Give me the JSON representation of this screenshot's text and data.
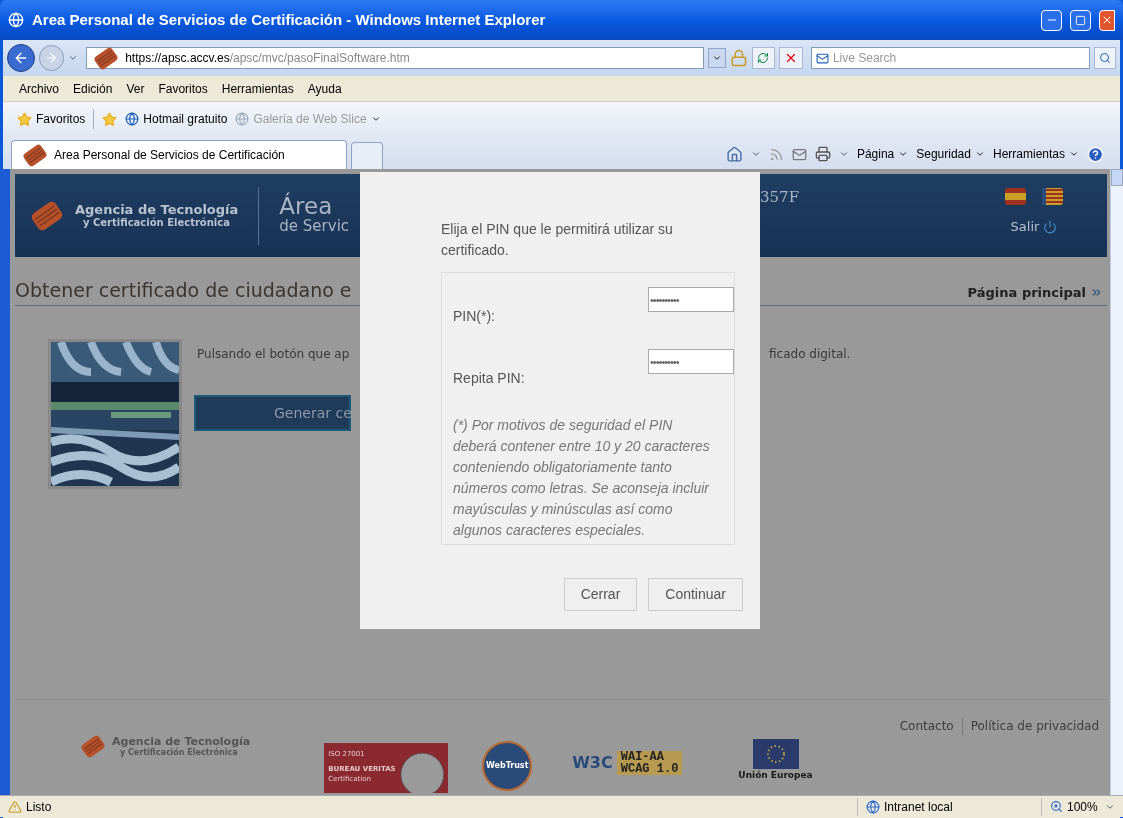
{
  "window": {
    "title": "Area Personal de Servicios de Certificación - Windows Internet Explorer"
  },
  "address_bar": {
    "host": "https://apsc.accv.es",
    "path": "/apsc/mvc/pasoFinalSoftware.htm"
  },
  "search": {
    "placeholder": "Live Search"
  },
  "menu": [
    "Archivo",
    "Edición",
    "Ver",
    "Favoritos",
    "Herramientas",
    "Ayuda"
  ],
  "favorites_bar": {
    "label": "Favoritos",
    "links": [
      {
        "label": "Hotmail gratuito",
        "disabled": false
      },
      {
        "label": "Galería de Web Slice",
        "disabled": true
      }
    ]
  },
  "tabs": [
    {
      "label": "Area Personal de Servicios de Certificación",
      "selected": true
    }
  ],
  "command_bar": [
    "Página",
    "Seguridad",
    "Herramientas"
  ],
  "page": {
    "header": {
      "org_line1": "Agencia de Tecnología",
      "org_line2": "y Certificación Electrónica",
      "area_title": "Área",
      "area_subtitle": "de Servic",
      "user_id": "357F",
      "logout": "Salir"
    },
    "title": "Obtener certificado de ciudadano e",
    "home_link": "Página principal",
    "intro_left": "Pulsando el botón que ap",
    "intro_right": "ficado digital.",
    "generate_button": "Generar ce",
    "footer": {
      "links": [
        "Contacto",
        "Política de privacidad"
      ],
      "org_line1": "Agencia de Tecnología",
      "org_line2": "y Certificación Electrónica",
      "iso": "ISO 27001",
      "iso_name": "BUREAU VERITAS",
      "iso_sub": "Certification",
      "webtrust": "WebTrust",
      "w3c": "W3C",
      "wai": "WAI-AA",
      "wcag": "WCAG 1.0",
      "eu": "Unión Europea"
    }
  },
  "dialog": {
    "prompt": "Elija el PIN que le permitirá utilizar su certificado.",
    "fields": [
      {
        "label": "PIN(*):",
        "value": "••••••••••"
      },
      {
        "label": "Repita PIN:",
        "value": "••••••••••"
      }
    ],
    "note": "(*) Por motivos de seguridad el PIN deberá contener entre 10 y 20 caracteres conteniendo obligatoriamente tanto números como letras. Se aconseja incluir mayúsculas y minúsculas así como algunos caracteres especiales.",
    "buttons": [
      "Cerrar",
      "Continuar"
    ]
  },
  "status_bar": {
    "text": "Listo",
    "zone": "Intranet local",
    "zoom": "100%"
  }
}
